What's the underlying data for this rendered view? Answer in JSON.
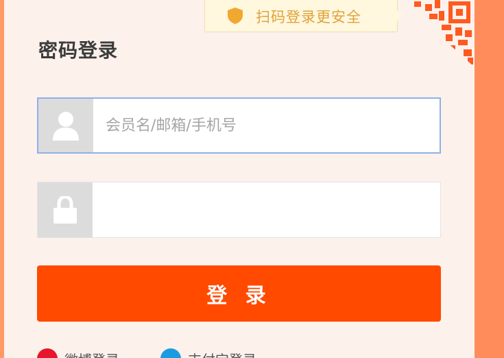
{
  "tip": {
    "text": "扫码登录更安全",
    "icon": "shield-icon"
  },
  "title": "密码登录",
  "username": {
    "placeholder": "会员名/邮箱/手机号",
    "value": "",
    "icon": "user-icon"
  },
  "password": {
    "placeholder": "",
    "value": "",
    "icon": "lock-icon"
  },
  "login_button": "登 录",
  "alt_logins": [
    {
      "label": "微博登录",
      "color": "#e6162d"
    },
    {
      "label": "支付宝登录",
      "color": "#1a9ce0"
    }
  ],
  "colors": {
    "accent": "#ff4a00",
    "background": "#ff8c5a",
    "panel": "#fdf1ec",
    "tip_text": "#e0a23a"
  }
}
